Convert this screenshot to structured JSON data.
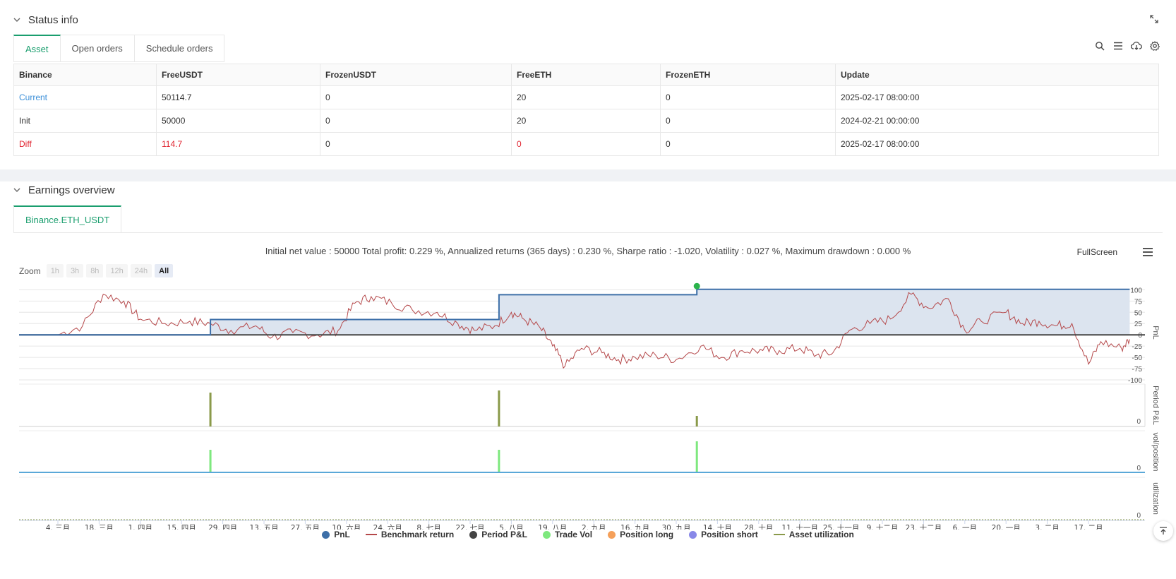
{
  "status_panel": {
    "title": "Status info",
    "tabs": [
      {
        "label": "Asset"
      },
      {
        "label": "Open orders"
      },
      {
        "label": "Schedule orders"
      }
    ],
    "toolbar_icons": [
      "search-icon",
      "list-icon",
      "cloud-download-icon",
      "gear-icon"
    ],
    "table": {
      "headers": [
        "Binance",
        "FreeUSDT",
        "FrozenUSDT",
        "FreeETH",
        "FrozenETH",
        "Update"
      ],
      "rows": [
        [
          "Current",
          "50114.7",
          "0",
          "20",
          "0",
          "2025-02-17 08:00:00"
        ],
        [
          "Init",
          "50000",
          "0",
          "20",
          "0",
          "2024-02-21 00:00:00"
        ],
        [
          "Diff",
          "114.7",
          "0",
          "0",
          "0",
          "2025-02-17 08:00:00"
        ]
      ]
    }
  },
  "earnings_panel": {
    "title": "Earnings overview",
    "tab": "Binance.ETH_USDT",
    "summary": "Initial net value : 50000 Total profit: 0.229 %, Annualized returns (365 days) : 0.230 %, Sharpe ratio : -1.020, Volatility : 0.027 %, Maximum drawdown : 0.000 %",
    "fullscreen_label": "FullScreen",
    "zoom": {
      "label": "Zoom",
      "buttons": [
        "1h",
        "3h",
        "8h",
        "12h",
        "24h",
        "All"
      ],
      "active": "All"
    },
    "legend": [
      {
        "name": "PnL",
        "color": "#3d6fa8",
        "kind": "dot"
      },
      {
        "name": "Benchmark return",
        "color": "#b5484a",
        "kind": "line"
      },
      {
        "name": "Period P&L",
        "color": "#444444",
        "kind": "dot"
      },
      {
        "name": "Trade Vol",
        "color": "#7ee87e",
        "kind": "dot"
      },
      {
        "name": "Position long",
        "color": "#f5a05a",
        "kind": "dot"
      },
      {
        "name": "Position short",
        "color": "#8888e8",
        "kind": "dot"
      },
      {
        "name": "Asset utilization",
        "color": "#8a9a4a",
        "kind": "line"
      }
    ]
  },
  "chart_data": {
    "type": "line",
    "x_ticks": [
      "4. 三月",
      "18. 三月",
      "1. 四月",
      "15. 四月",
      "29. 四月",
      "13. 五月",
      "27. 五月",
      "10. 六月",
      "24. 六月",
      "8. 七月",
      "22. 七月",
      "5. 八月",
      "19. 八月",
      "2. 九月",
      "16. 九月",
      "30. 九月",
      "14. 十月",
      "28. 十月",
      "11. 十一月",
      "25. 十一月",
      "9. 十二月",
      "23. 十二月",
      "6. 一月",
      "20. 一月",
      "3. 二月",
      "17. 二月"
    ],
    "pnl_axis": {
      "label": "PnL",
      "ticks": [
        100,
        75,
        50,
        25,
        0,
        -25,
        -50,
        -75,
        -100
      ],
      "range": [
        -100,
        110
      ]
    },
    "period_axis": {
      "label": "Period P&L",
      "ticks": [
        0
      ]
    },
    "vol_axis": {
      "label": "vol/position",
      "ticks": [
        0
      ]
    },
    "util_axis": {
      "label": "utilization",
      "ticks": [
        0
      ]
    },
    "pnl_series": {
      "name": "PnL",
      "points": [
        [
          0,
          0
        ],
        [
          3.7,
          0
        ],
        [
          3.7,
          34
        ],
        [
          10.7,
          34
        ],
        [
          10.7,
          89
        ],
        [
          15.5,
          89
        ],
        [
          15.5,
          101
        ],
        [
          26.0,
          101
        ]
      ]
    },
    "benchmark_series": {
      "name": "Benchmark return",
      "anchors": [
        [
          0,
          0
        ],
        [
          0.6,
          20
        ],
        [
          1.1,
          90
        ],
        [
          1.6,
          75
        ],
        [
          2.0,
          35
        ],
        [
          2.6,
          25
        ],
        [
          3.2,
          30
        ],
        [
          3.7,
          25
        ],
        [
          4.2,
          10
        ],
        [
          4.8,
          20
        ],
        [
          5.2,
          -5
        ],
        [
          5.7,
          5
        ],
        [
          6.3,
          0
        ],
        [
          6.8,
          10
        ],
        [
          7.2,
          70
        ],
        [
          7.6,
          85
        ],
        [
          8.1,
          70
        ],
        [
          8.6,
          55
        ],
        [
          9.2,
          50
        ],
        [
          9.7,
          25
        ],
        [
          10.1,
          10
        ],
        [
          10.6,
          20
        ],
        [
          11.0,
          50
        ],
        [
          11.3,
          35
        ],
        [
          11.7,
          15
        ],
        [
          12.0,
          -25
        ],
        [
          12.3,
          -70
        ],
        [
          12.7,
          -30
        ],
        [
          13.2,
          -40
        ],
        [
          13.6,
          -55
        ],
        [
          14.0,
          -50
        ],
        [
          14.5,
          -45
        ],
        [
          15.0,
          -55
        ],
        [
          15.6,
          -25
        ],
        [
          16.1,
          -50
        ],
        [
          16.6,
          -35
        ],
        [
          17.1,
          -35
        ],
        [
          17.5,
          -35
        ],
        [
          18.0,
          -30
        ],
        [
          18.4,
          -45
        ],
        [
          18.8,
          -40
        ],
        [
          19.2,
          10
        ],
        [
          19.7,
          25
        ],
        [
          20.2,
          35
        ],
        [
          20.7,
          90
        ],
        [
          21.1,
          60
        ],
        [
          21.6,
          80
        ],
        [
          22.0,
          10
        ],
        [
          22.4,
          30
        ],
        [
          23.0,
          50
        ],
        [
          23.4,
          25
        ],
        [
          23.8,
          30
        ],
        [
          24.2,
          20
        ],
        [
          24.6,
          25
        ],
        [
          25.0,
          -65
        ],
        [
          25.3,
          -15
        ],
        [
          25.8,
          -30
        ],
        [
          26.0,
          -10
        ]
      ]
    },
    "period_pnl_bars": [
      [
        3.7,
        80
      ],
      [
        10.7,
        85
      ],
      [
        15.5,
        25
      ]
    ],
    "trade_vol_bars": [
      [
        3.7,
        55
      ],
      [
        10.7,
        55
      ],
      [
        15.5,
        75
      ]
    ]
  }
}
